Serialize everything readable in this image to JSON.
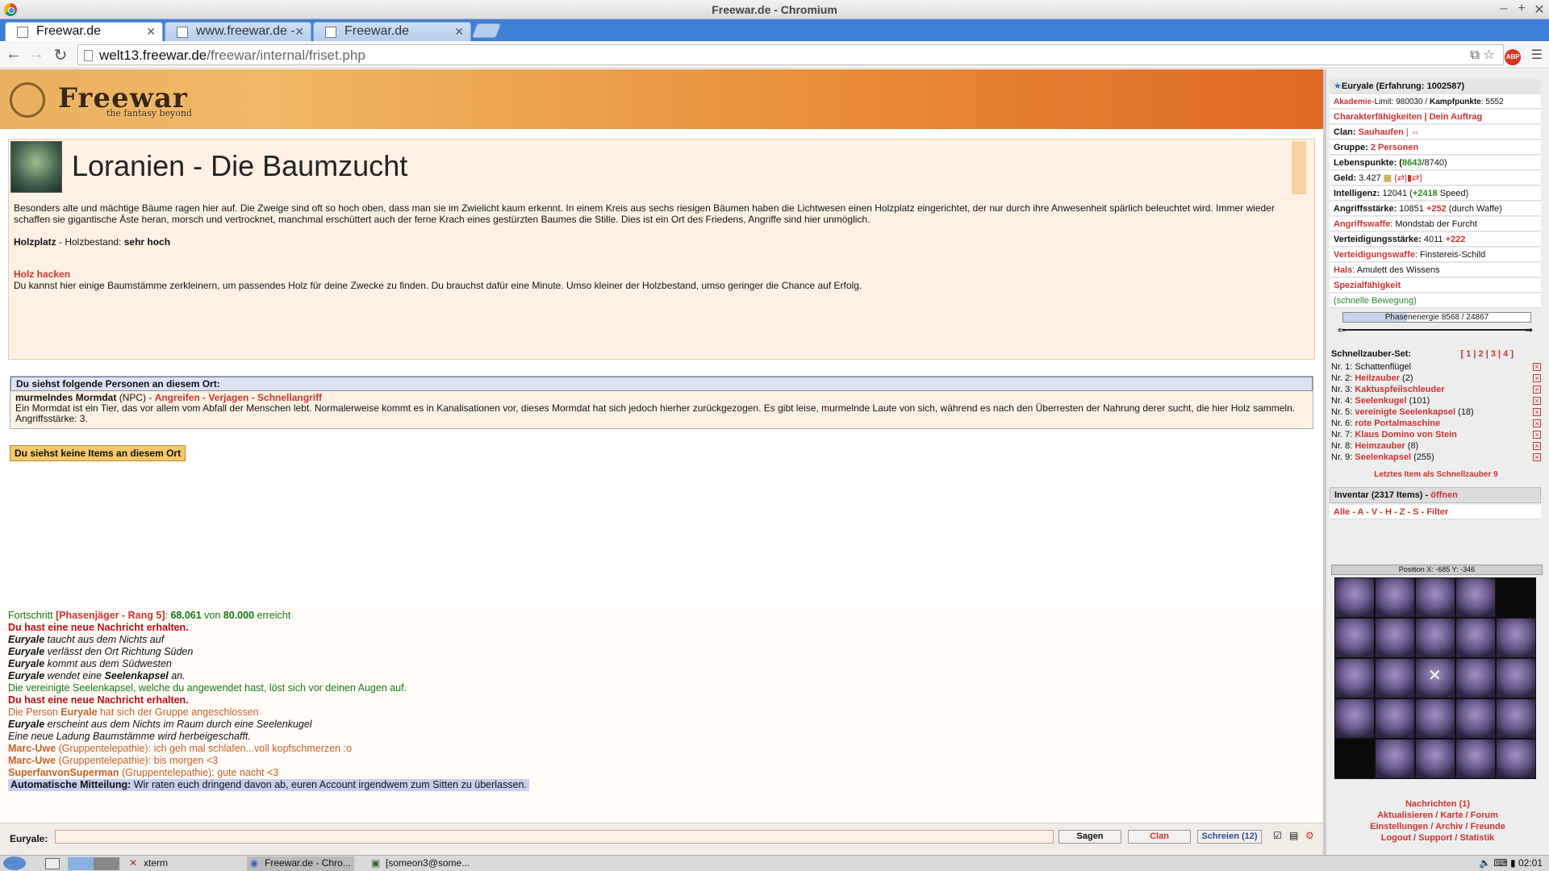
{
  "window": {
    "title": "Freewar.de - Chromium"
  },
  "tabs": [
    {
      "label": "Freewar.de",
      "active": true
    },
    {
      "label": "www.freewar.de -",
      "active": false
    },
    {
      "label": "Freewar.de",
      "active": false
    }
  ],
  "omnibox": {
    "host": "welt13.freewar.de",
    "path": "/freewar/internal/friset.php"
  },
  "banner": {
    "logo": "Freewar",
    "tagline": "the fantasy beyond"
  },
  "place": {
    "title": "Loranien - Die Baumzucht",
    "description": "Besonders alte und mächtige Bäume ragen hier auf. Die Zweige sind oft so hoch oben, dass man sie im Zwielicht kaum erkennt. In einem Kreis aus sechs riesigen Bäumen haben die Lichtwesen einen Holzplatz eingerichtet, der nur durch ihre Anwesenheit spärlich beleuchtet wird. Immer wieder schaffen sie gigantische Äste heran, morsch und vertrocknet, manchmal erschüttert auch der ferne Krach eines gestürzten Baumes die Stille. Dies ist ein Ort des Friedens, Angriffe sind hier unmöglich.",
    "resource_label": "Holzplatz",
    "resource_mid": " - Holzbestand: ",
    "resource_value": "sehr hoch",
    "action": "Holz hacken",
    "action_desc": "Du kannst hier einige Baumstämme zerkleinern, um passendes Holz für deine Zwecke zu finden. Du brauchst dafür eine Minute. Umso kleiner der Holzbestand, umso geringer die Chance auf Erfolg."
  },
  "persons": {
    "header": "Du siehst folgende Personen an diesem Ort:",
    "npc_name": "murmelndes Mormdat",
    "npc_tag": " (NPC) - ",
    "npc_actions": "Angreifen - Verjagen - Schnellangriff",
    "npc_desc": "Ein Mormdat ist ein Tier, das vor allem vom Abfall der Menschen lebt. Normalerweise kommt es in Kanalisationen vor, dieses Mormdat hat sich jedoch hierher zurückgezogen. Es gibt leise, murmelnde Laute von sich, während es nach den Überresten der Nahrung derer sucht, die hier Holz sammeln. Angriffsstärke: 3."
  },
  "items_button": "Du siehst keine Items an diesem Ort",
  "log": {
    "progress_pre": "Fortschritt ",
    "progress_rank": "[Phasenjäger - Rang 5]",
    "progress_colon": ": ",
    "progress_val": "68.061",
    "progress_von": " von ",
    "progress_max": "80.000",
    "progress_post": " erreicht",
    "l1": "Du hast eine neue Nachricht erhalten.",
    "n": "Euryale",
    "l2": " taucht aus dem Nichts auf",
    "l3": " verlässt den Ort Richtung Süden",
    "l4": " kommt aus dem Südwesten",
    "l5a": " wendet eine ",
    "l5b": "Seelenkapsel",
    "l5c": " an.",
    "l6": "Die vereinigte Seelenkapsel, welche du angewendet hast, löst sich vor deinen Augen auf.",
    "l7": "Du hast eine neue Nachricht erhalten.",
    "l8a": "Die Person ",
    "l8b": " hat sich der Gruppe angeschlossen",
    "l9": " erscheint aus dem Nichts im Raum durch eine Seelenkugel",
    "l10": "Eine neue Ladung Baumstämme wird herbeigeschafft.",
    "c1n": "Marc-Uwe",
    "c1": " (Gruppentelepathie): ich geh mal schlafen...voll kopfschmerzen :o",
    "c2n": "Marc-Uwe",
    "c2": " (Gruppentelepathie): bis morgen <3",
    "c3n": "SuperfanvonSuperman",
    "c3": " (Gruppentelepathie): gute nacht <3",
    "auto_label": "Automatische Mitteilung:",
    "auto_text": " Wir raten euch dringend davon ab, euren Account irgendwem zum Sitten zu überlassen."
  },
  "chat": {
    "label": "Euryale:",
    "value": "",
    "sagen": "Sagen",
    "clan": "Clan",
    "schreien": "Schreien (12)"
  },
  "side": {
    "char": "Euryale (Erfahrung: 1002587)",
    "akademie": "Akademie",
    "limit": "-Limit: 980030 / ",
    "kp_label": "Kampfpunkte",
    "kp": ": 5552",
    "char_links": "Charakterfähigkeiten | Dein Auftrag",
    "clan_label": "Clan: ",
    "clan": "Sauhaufen",
    "gruppe_label": "Gruppe: ",
    "gruppe": "2 Personen",
    "lp_label": "Lebenspunkte: (",
    "lp_val": "8643",
    "lp_max": "/8740)",
    "geld_label": "Geld: ",
    "geld": "3.427",
    "int_label": "Intelligenz: ",
    "int": "12041 (",
    "int_bonus": "+2418",
    "int_post": " Speed)",
    "ang_label": "Angriffsstärke: ",
    "ang": "10851 ",
    "ang_bonus": "+252",
    "ang_post": " (durch Waffe)",
    "waffe_label": "Angriffswaffe",
    "waffe": ": Mondstab der Furcht",
    "vert_label": "Verteidigungsstärke: ",
    "vert": "4011 ",
    "vert_bonus": "+222",
    "vwaffe_label": "Verteidigungswaffe",
    "vwaffe": ": Finstereis-Schild",
    "hals_label": "Hals",
    "hals": ": Amulett des Wissens",
    "spezial": "Spezialfähigkeit",
    "spezial_sub": "(schnelle Bewegung)",
    "energy": "Phasenenergie 8568 / 24867",
    "energy_fraction": 0.34,
    "schnell": "Schnellzauber-Set:",
    "sets": "[ 1 | 2 | 3 | 4 ]",
    "spells": [
      {
        "nr": "Nr. 1:",
        "name": "Schattenflügel",
        "count": ""
      },
      {
        "nr": "Nr. 2:",
        "name": "Heilzauber",
        "count": " (2)"
      },
      {
        "nr": "Nr. 3:",
        "name": "Kaktuspfeilschleuder",
        "count": ""
      },
      {
        "nr": "Nr. 4:",
        "name": "Seelenkugel",
        "count": " (101)"
      },
      {
        "nr": "Nr. 5:",
        "name": "vereinigte Seelenkapsel",
        "count": " (18)"
      },
      {
        "nr": "Nr. 6:",
        "name": "rote Portalmaschine",
        "count": ""
      },
      {
        "nr": "Nr. 7:",
        "name": "Klaus Domino von Stein",
        "count": ""
      },
      {
        "nr": "Nr. 8:",
        "name": "Heimzauber",
        "count": " (8)"
      },
      {
        "nr": "Nr. 9:",
        "name": "Seelenkapsel",
        "count": " (255)"
      }
    ],
    "letztes": "Letztes Item als Schnellzauber 9",
    "inv": "Inventar (2317 Items) - ",
    "inv_open": "öffnen",
    "filter": "Alle - A - V - H - Z - S - Filter",
    "position": "Position X: -685 Y: -346",
    "links": [
      "Nachrichten (1)",
      "Aktualisieren / Karte / Forum",
      "Einstellungen / Archiv / Freunde",
      "Logout / Support / Statistik"
    ]
  },
  "taskbar": {
    "xterm": "xterm",
    "browser": "Freewar.de - Chro...",
    "term2": "[someon3@some...",
    "clock": "02:01"
  }
}
